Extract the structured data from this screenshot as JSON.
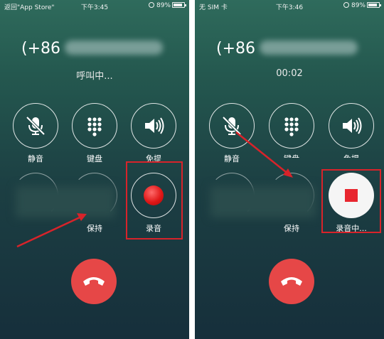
{
  "left": {
    "status": {
      "carrier": "返回\"App Store\"",
      "time": "下午3:45",
      "battery": "89%"
    },
    "number_prefix": "(+86",
    "call_status": "呼叫中...",
    "controls": {
      "mute": "静音",
      "keypad": "键盘",
      "speaker": "免提",
      "hold": "保持",
      "record": "录音"
    }
  },
  "right": {
    "status": {
      "carrier": "无 SIM 卡",
      "time": "下午3:46",
      "battery": "89%"
    },
    "number_prefix": "(+86",
    "call_status": "00:02",
    "controls": {
      "mute": "静音",
      "keypad": "键盘",
      "speaker": "免提",
      "hold": "保持",
      "record": "录音中..."
    }
  },
  "colors": {
    "highlight": "#d8232a",
    "end_call": "#e64747",
    "record_red": "#e01818"
  },
  "icons": [
    "microphone-slash-icon",
    "keypad-grid-icon",
    "speaker-icon",
    "record-dot-icon",
    "stop-icon",
    "hang-up-icon"
  ]
}
